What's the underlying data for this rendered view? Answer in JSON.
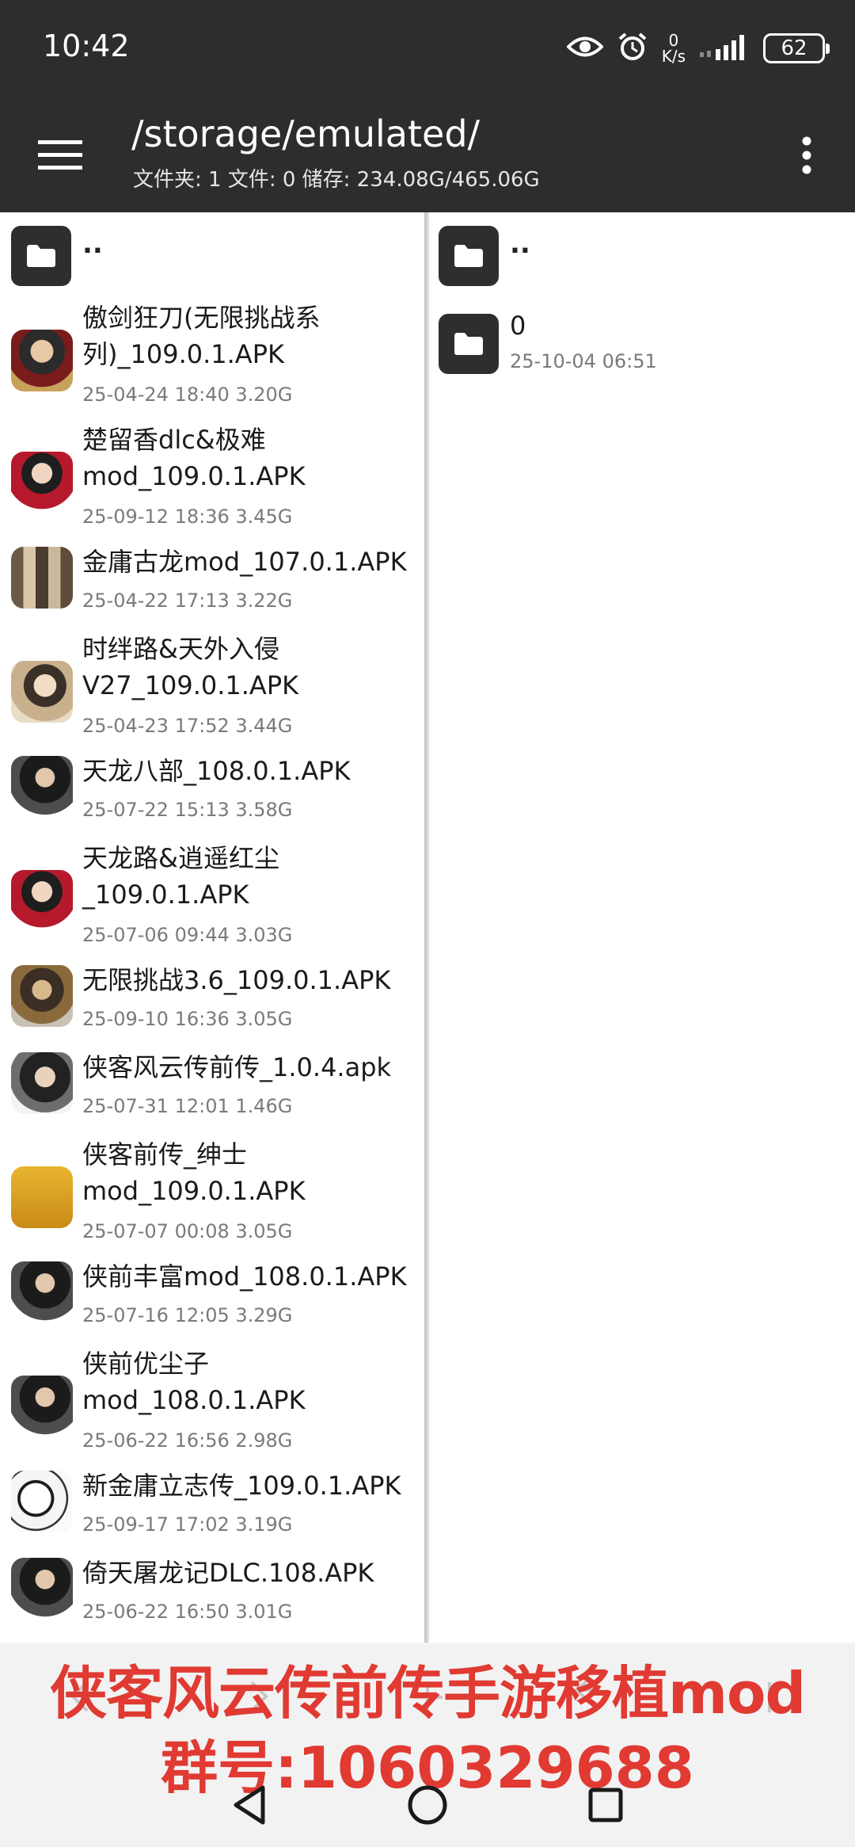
{
  "status_bar": {
    "time": "10:42",
    "speed_value": "0",
    "speed_unit": "K/s",
    "battery": "62",
    "icons": [
      "eye-icon",
      "alarm-icon",
      "signal-icon",
      "battery-icon"
    ]
  },
  "toolbar": {
    "path": "/storage/emulated/",
    "summary": "文件夹: 1  文件: 0  储存: 234.08G/465.06G"
  },
  "left_pane": {
    "parent_label": "..",
    "files": [
      {
        "name": "傲剑狂刀(无限挑战系列)_109.0.1.APK",
        "meta": "25-04-24 18:40  3.20G"
      },
      {
        "name": "楚留香dlc&极难mod_109.0.1.APK",
        "meta": "25-09-12 18:36  3.45G"
      },
      {
        "name": "金庸古龙mod_107.0.1.APK",
        "meta": "25-04-22 17:13  3.22G"
      },
      {
        "name": "时绊路&天外入侵V27_109.0.1.APK",
        "meta": "25-04-23 17:52  3.44G"
      },
      {
        "name": "天龙八部_108.0.1.APK",
        "meta": "25-07-22 15:13  3.58G"
      },
      {
        "name": "天龙路&逍遥红尘_109.0.1.APK",
        "meta": "25-07-06 09:44  3.03G"
      },
      {
        "name": "无限挑战3.6_109.0.1.APK",
        "meta": "25-09-10 16:36  3.05G"
      },
      {
        "name": "侠客风云传前传_1.0.4.apk",
        "meta": "25-07-31 12:01  1.46G"
      },
      {
        "name": "侠客前传_绅士mod_109.0.1.APK",
        "meta": "25-07-07 00:08  3.05G"
      },
      {
        "name": "侠前丰富mod_108.0.1.APK",
        "meta": "25-07-16 12:05  3.29G"
      },
      {
        "name": "侠前优尘子mod_108.0.1.APK",
        "meta": "25-06-22 16:56  2.98G"
      },
      {
        "name": "新金庸立志传_109.0.1.APK",
        "meta": "25-09-17 17:02  3.19G"
      },
      {
        "name": "倚天屠龙记DLC.108.APK",
        "meta": "25-06-22 16:50  3.01G"
      }
    ]
  },
  "right_pane": {
    "parent_label": "..",
    "folders": [
      {
        "name": "0",
        "meta": "25-10-04 06:51"
      }
    ]
  },
  "banner": {
    "line1": "侠客风云传前传手游移植mod",
    "line2": "群号:1060329688"
  },
  "colors": {
    "toolbar_bg": "#2d2d2d",
    "banner_text": "#e03a32",
    "folder_icon_bg": "#2e2e2e"
  }
}
